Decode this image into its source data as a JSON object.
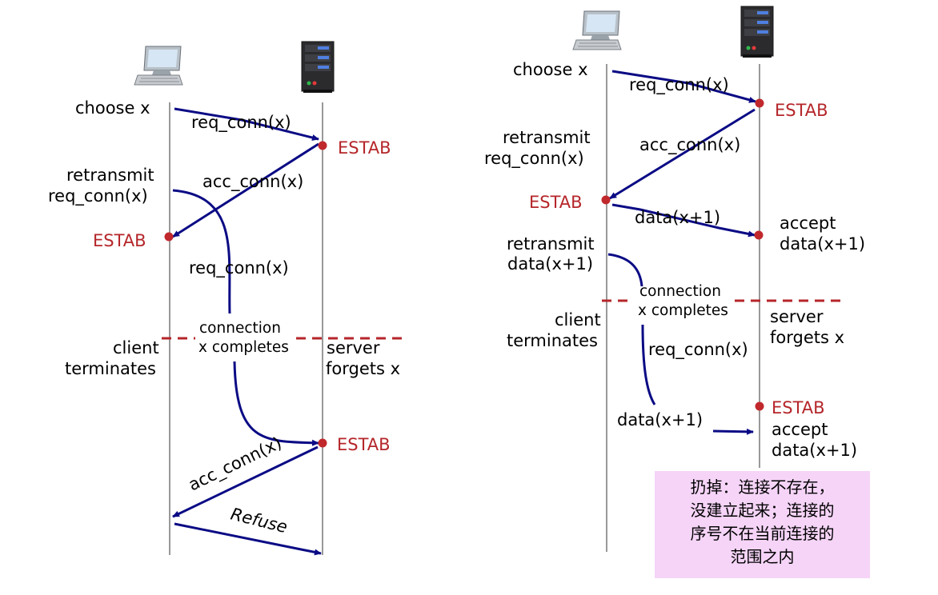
{
  "left": {
    "client_choose": "choose x",
    "msg_req_conn_1": "req_conn(x)",
    "server_estab_1": "ESTAB",
    "client_retransmit_1": "retransmit",
    "client_retransmit_2": "req_conn(x)",
    "msg_acc_conn_1": "acc_conn(x)",
    "client_estab": "ESTAB",
    "msg_req_conn_2": "req_conn(x)",
    "connection_1": "connection",
    "connection_2": "x completes",
    "client_terminates_1": "client",
    "client_terminates_2": "terminates",
    "server_forgets_1": "server",
    "server_forgets_2": "forgets x",
    "server_estab_2": "ESTAB",
    "msg_acc_conn_2": "acc_conn(x)",
    "msg_refuse": "Refuse"
  },
  "right": {
    "client_choose": "choose x",
    "msg_req_conn_1": "req_conn(x)",
    "server_estab_1": "ESTAB",
    "client_retransmit_1": "retransmit",
    "client_retransmit_2": "req_conn(x)",
    "msg_acc_conn": "acc_conn(x)",
    "client_estab": "ESTAB",
    "msg_data_1": "data(x+1)",
    "server_accept_1": "accept",
    "server_accept_2": "data(x+1)",
    "client_retransmit_data_1": "retransmit",
    "client_retransmit_data_2": "data(x+1)",
    "connection_1": "connection",
    "connection_2": "x completes",
    "client_terminates_1": "client",
    "client_terminates_2": "terminates",
    "server_forgets_1": "server",
    "server_forgets_2": "forgets x",
    "msg_req_conn_2": "req_conn(x)",
    "server_estab_2": "ESTAB",
    "server_accept_3": "accept",
    "server_accept_4": "data(x+1)",
    "msg_data_2": "data(x+1)"
  },
  "note": {
    "line1": "扔掉：连接不存在，",
    "line2": "没建立起来；连接的",
    "line3": "序号不在当前连接的",
    "line4": "范围之内"
  },
  "colors": {
    "arrow": "#0b0b85",
    "estab": "#b5262a",
    "dashed": "#b5262a",
    "note_bg": "#f5d4f7"
  }
}
